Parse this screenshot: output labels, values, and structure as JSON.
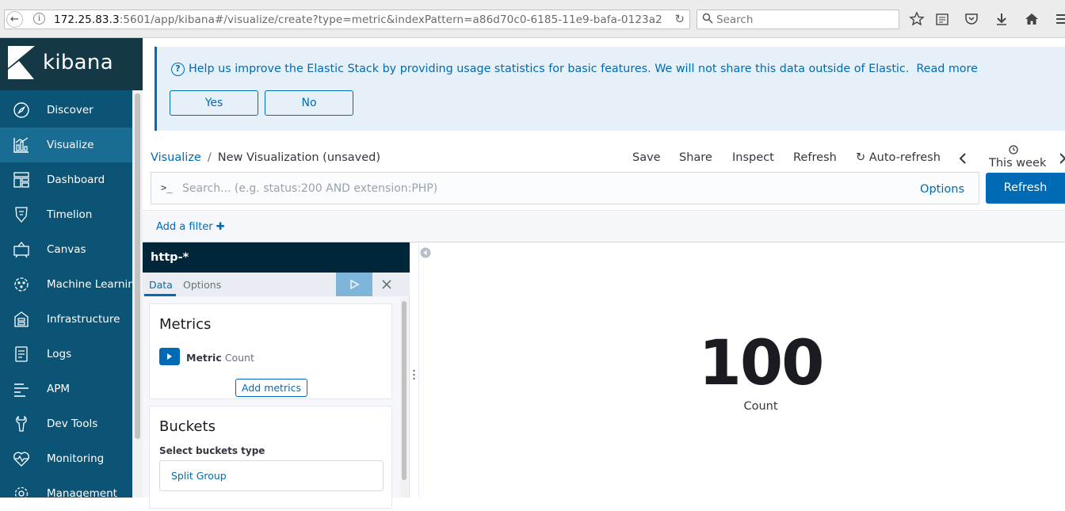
{
  "browser": {
    "url_host": "172.25.83.3",
    "url_rest": ":5601/app/kibana#/visualize/create?type=metric&indexPattern=a86d70c0-6185-11e9-bafa-0123a2",
    "search_placeholder": "Search"
  },
  "app": {
    "logo_text": "kibana"
  },
  "sidebar": {
    "items": [
      {
        "label": "Discover",
        "icon": "compass-icon"
      },
      {
        "label": "Visualize",
        "icon": "visualize-icon",
        "active": true
      },
      {
        "label": "Dashboard",
        "icon": "dashboard-icon"
      },
      {
        "label": "Timelion",
        "icon": "timelion-icon"
      },
      {
        "label": "Canvas",
        "icon": "canvas-icon"
      },
      {
        "label": "Machine Learning",
        "icon": "ml-icon"
      },
      {
        "label": "Infrastructure",
        "icon": "infrastructure-icon"
      },
      {
        "label": "Logs",
        "icon": "logs-icon"
      },
      {
        "label": "APM",
        "icon": "apm-icon"
      },
      {
        "label": "Dev Tools",
        "icon": "devtools-icon"
      },
      {
        "label": "Monitoring",
        "icon": "monitoring-icon"
      },
      {
        "label": "Management",
        "icon": "gear-icon"
      }
    ]
  },
  "banner": {
    "message": "Help us improve the Elastic Stack by providing usage statistics for basic features. We will not share this data outside of Elastic.",
    "read_more": "Read more",
    "yes_label": "Yes",
    "no_label": "No"
  },
  "breadcrumb": {
    "root": "Visualize",
    "separator": "/",
    "current": "New Visualization (unsaved)"
  },
  "top_menu": {
    "save": "Save",
    "share": "Share",
    "inspect": "Inspect",
    "refresh": "Refresh",
    "auto_refresh": "Auto-refresh",
    "time_range": "This week"
  },
  "query": {
    "prompt": ">_",
    "placeholder": "Search... (e.g. status:200 AND extension:PHP)",
    "options": "Options",
    "refresh_button": "Refresh"
  },
  "filter": {
    "add_filter": "Add a filter"
  },
  "editor": {
    "index_pattern": "http-*",
    "tabs": {
      "data": "Data",
      "options": "Options"
    },
    "metrics": {
      "title": "Metrics",
      "metric_label": "Metric",
      "metric_value": "Count",
      "add_button": "Add metrics"
    },
    "buckets": {
      "title": "Buckets",
      "select_label": "Select buckets type",
      "split_group": "Split Group"
    }
  },
  "visualization": {
    "value": "100",
    "label": "Count"
  },
  "colors": {
    "sidebar": "#0b5476",
    "accent": "#006bb4",
    "header": "#00263a"
  }
}
